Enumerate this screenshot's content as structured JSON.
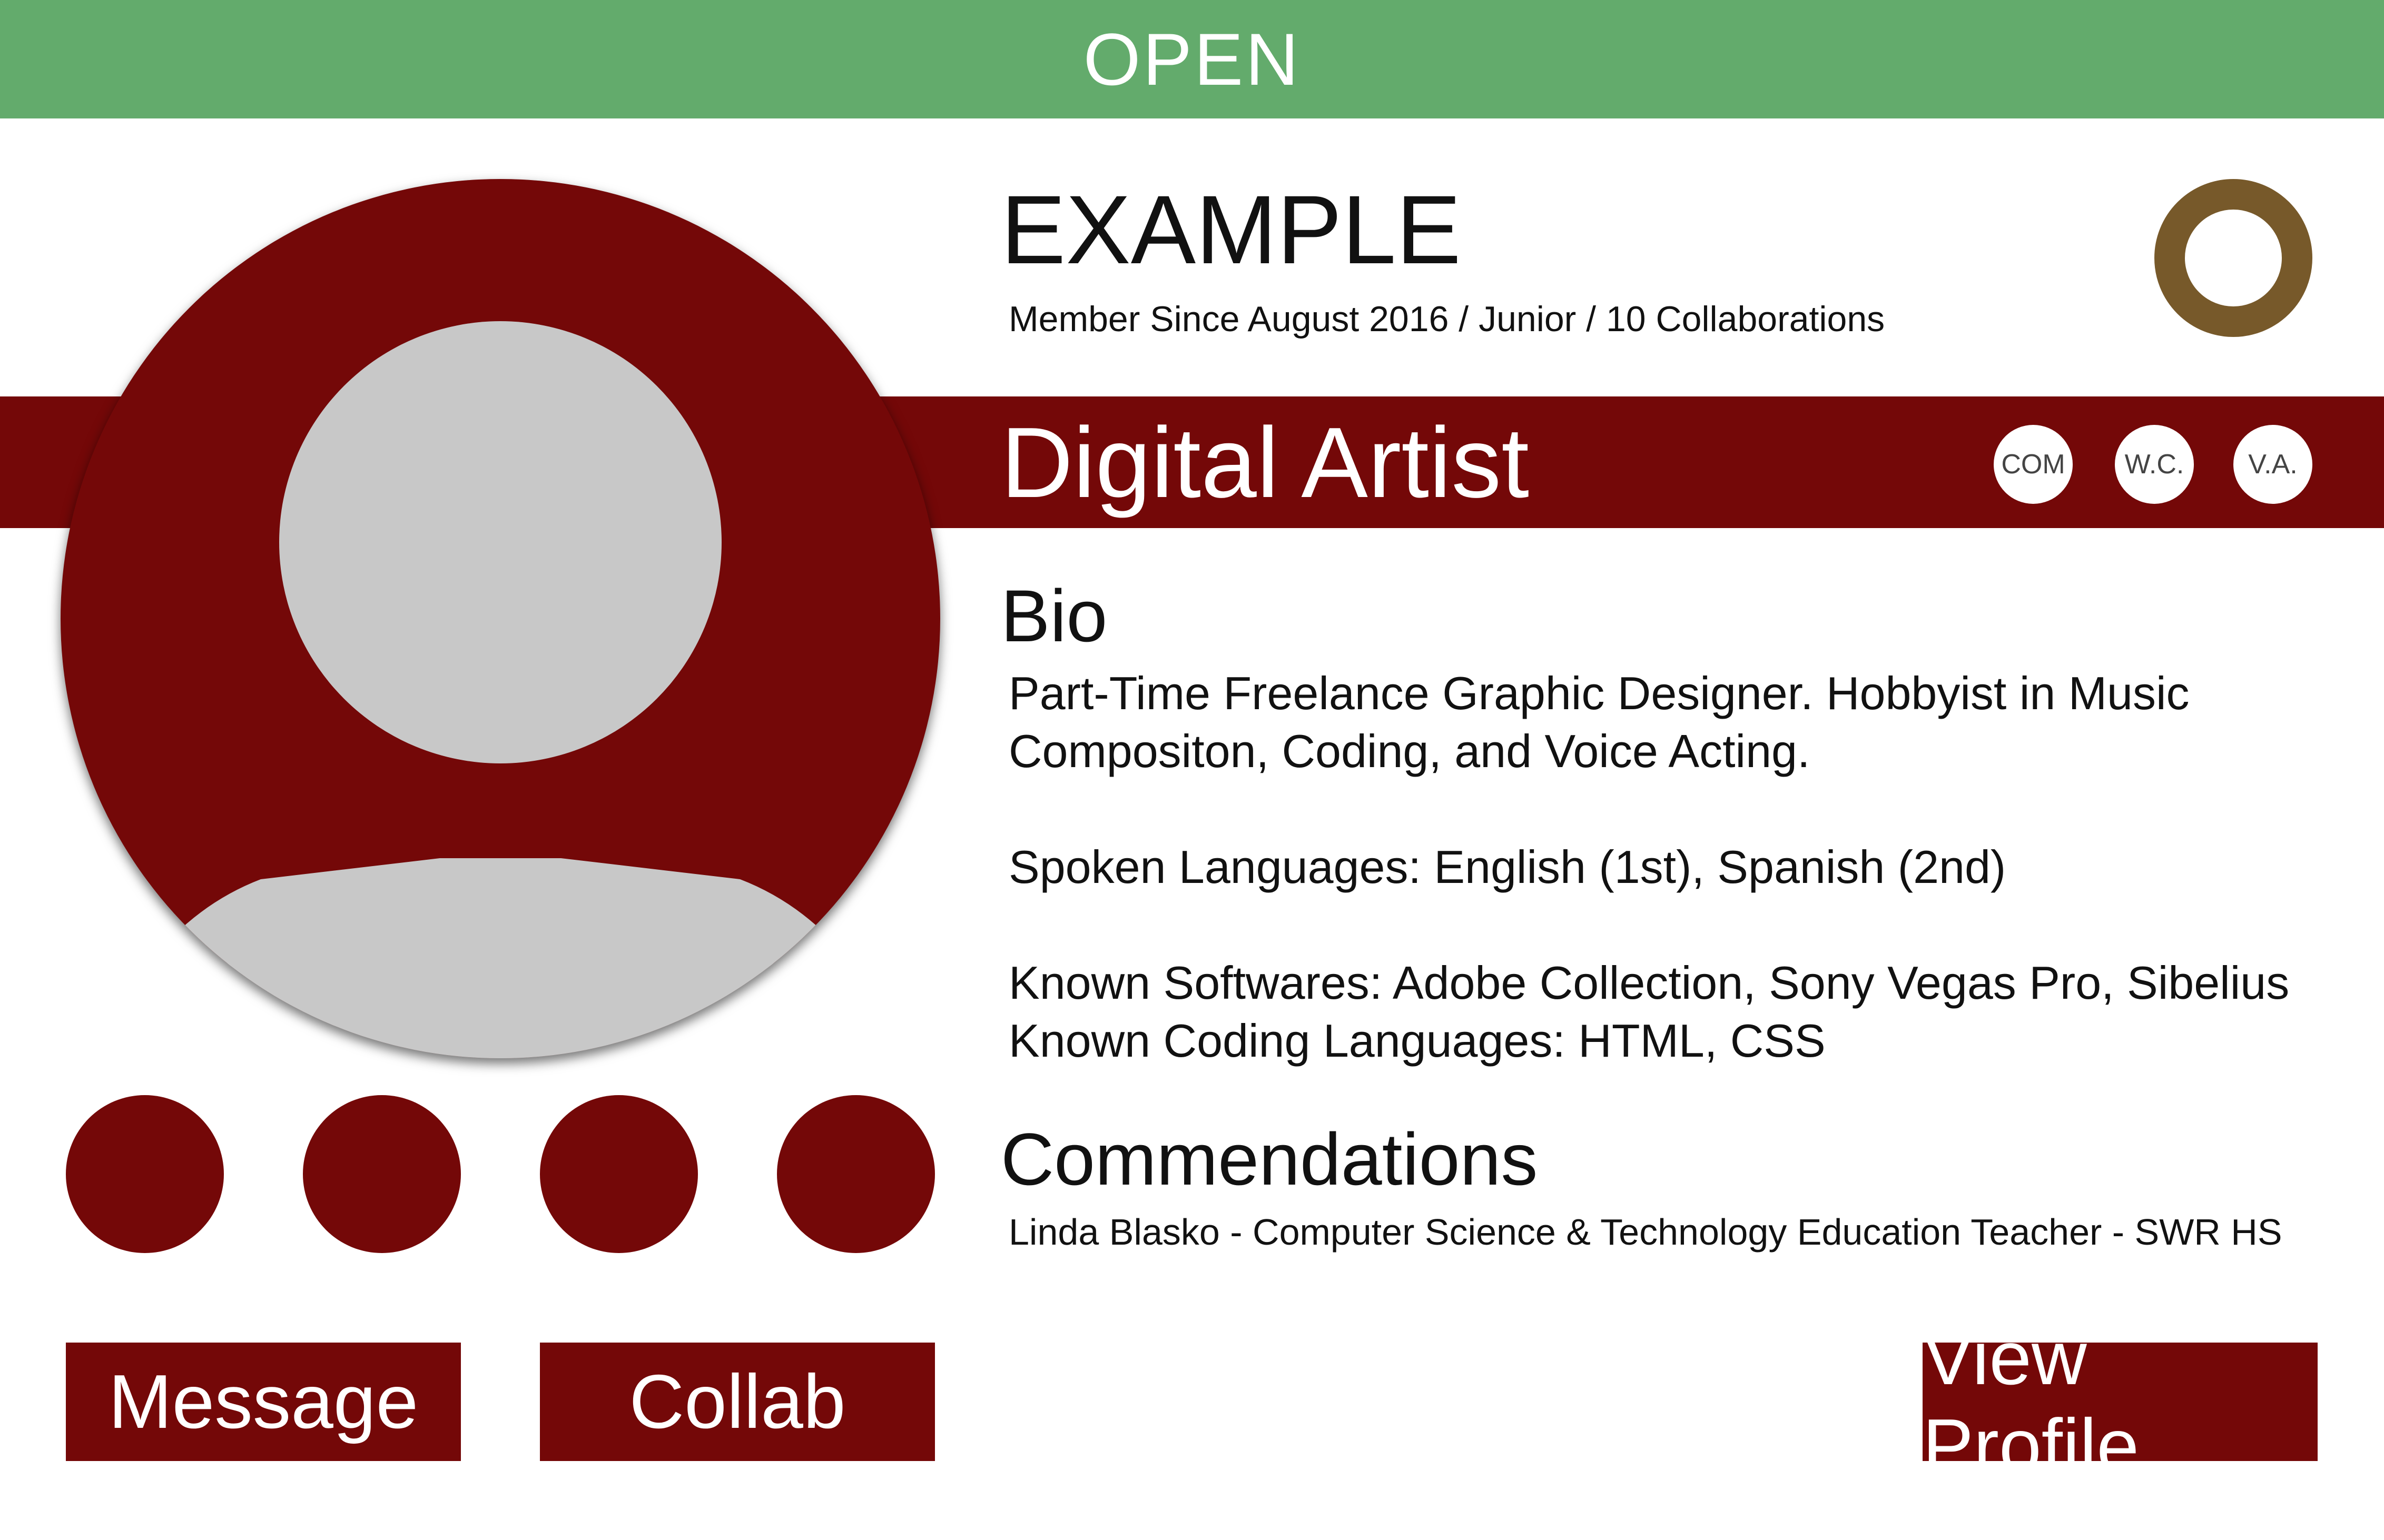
{
  "status": {
    "label": "OPEN",
    "color": "#63ab6c"
  },
  "profile": {
    "name": "EXAMPLE",
    "meta": "Member Since August 2016 / Junior / 10 Collaborations",
    "role": "Digital Artist",
    "rank_icon": "ring-icon",
    "skill_badges": [
      "COM",
      "W.C.",
      "V.A."
    ]
  },
  "bio": {
    "heading": "Bio",
    "lines": [
      "Part-Time Freelance Graphic Designer. Hobbyist in Music",
      "Compositon, Coding, and Voice Acting.",
      "Spoken Languages: English (1st), Spanish (2nd)",
      "Known Softwares: Adobe Collection, Sony Vegas Pro, Sibelius",
      "Known Coding Languages: HTML, CSS"
    ]
  },
  "commendations": {
    "heading": "Commendations",
    "items": [
      "Linda Blasko - Computer Science & Technology Education Teacher - SWR HS"
    ]
  },
  "buttons": {
    "message": "Message",
    "collab": "Collab",
    "view_profile": "View Profile"
  },
  "colors": {
    "brand": "#740808",
    "accent_ring": "#77592a",
    "avatar_silhouette": "#c8c8c8"
  }
}
